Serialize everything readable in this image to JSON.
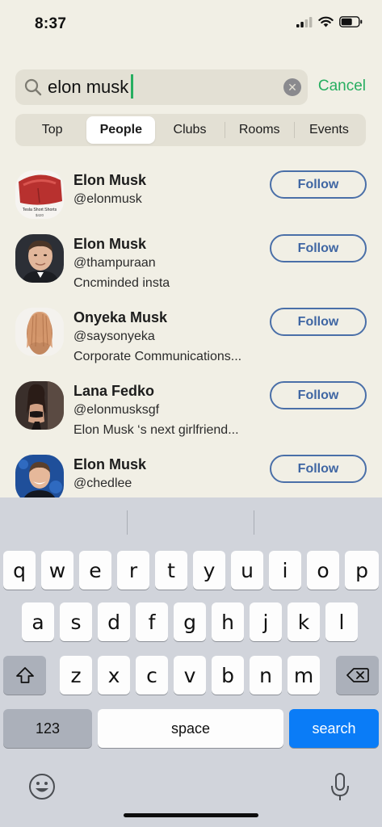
{
  "status": {
    "time": "8:37"
  },
  "search": {
    "query": "elon musk",
    "cancel": "Cancel"
  },
  "tabs": [
    {
      "label": "Top",
      "active": false
    },
    {
      "label": "People",
      "active": true
    },
    {
      "label": "Clubs",
      "active": false
    },
    {
      "label": "Rooms",
      "active": false
    },
    {
      "label": "Events",
      "active": false
    }
  ],
  "results": [
    {
      "name": "Elon Musk",
      "handle": "@elonmusk",
      "bio": "",
      "avatar_text": "Tesla Short Shorts",
      "avatar_sub": "$420",
      "button": "Follow"
    },
    {
      "name": "Elon Musk",
      "handle": "@thampuraan",
      "bio": "Cncminded insta",
      "button": "Follow"
    },
    {
      "name": "Onyeka Musk",
      "handle": "@saysonyeka",
      "bio": "Corporate Communications...",
      "button": "Follow"
    },
    {
      "name": "Lana Fedko",
      "handle": "@elonmusksgf",
      "bio": "Elon Musk ‘s next girlfriend...",
      "button": "Follow"
    },
    {
      "name": "Elon Musk",
      "handle": "@chedlee",
      "bio": "",
      "button": "Follow"
    }
  ],
  "keyboard": {
    "row1": [
      "q",
      "w",
      "e",
      "r",
      "t",
      "y",
      "u",
      "i",
      "o",
      "p"
    ],
    "row2": [
      "a",
      "s",
      "d",
      "f",
      "g",
      "h",
      "j",
      "k",
      "l"
    ],
    "row3": [
      "z",
      "x",
      "c",
      "v",
      "b",
      "n",
      "m"
    ],
    "numbers": "123",
    "space": "space",
    "action": "search"
  },
  "colors": {
    "accent_green": "#27ae60",
    "follow_blue": "#3f66a3",
    "search_key_blue": "#0a7cf7",
    "background": "#f1efe5"
  }
}
